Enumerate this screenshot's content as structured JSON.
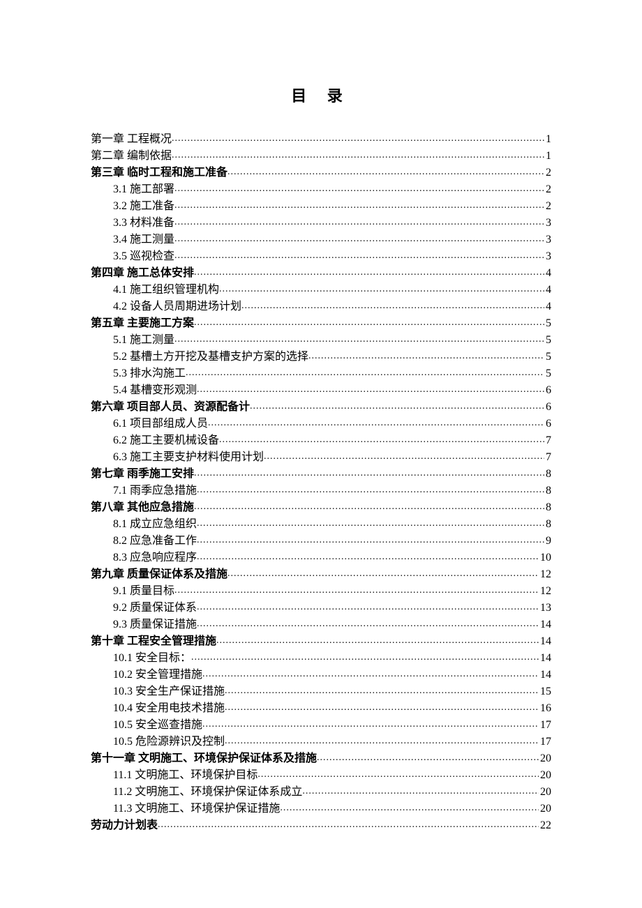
{
  "title": "目 录",
  "entries": [
    {
      "label": "第一章  工程概况",
      "page": "1",
      "bold": false,
      "indent": false
    },
    {
      "label": "第二章  编制依据",
      "page": "1",
      "bold": false,
      "indent": false
    },
    {
      "label": "第三章  临时工程和施工准备",
      "page": "2",
      "bold": true,
      "indent": false
    },
    {
      "label": "3.1 施工部署",
      "page": "2",
      "bold": false,
      "indent": true
    },
    {
      "label": "3.2 施工准备",
      "page": "2",
      "bold": false,
      "indent": true
    },
    {
      "label": "3.3 材料准备",
      "page": "3",
      "bold": false,
      "indent": true
    },
    {
      "label": "3.4 施工测量",
      "page": "3",
      "bold": false,
      "indent": true
    },
    {
      "label": "3.5 巡视检查",
      "page": "3",
      "bold": false,
      "indent": true
    },
    {
      "label": "第四章  施工总体安排",
      "page": "4",
      "bold": true,
      "indent": false
    },
    {
      "label": "4.1 施工组织管理机构",
      "page": "4",
      "bold": false,
      "indent": true
    },
    {
      "label": "4.2 设备人员周期进场计划",
      "page": "4",
      "bold": false,
      "indent": true
    },
    {
      "label": "第五章  主要施工方案",
      "page": "5",
      "bold": true,
      "indent": false
    },
    {
      "label": "5.1 施工测量",
      "page": "5",
      "bold": false,
      "indent": true
    },
    {
      "label": "5.2 基槽土方开挖及基槽支护方案的选择",
      "page": "5",
      "bold": false,
      "indent": true
    },
    {
      "label": "5.3 排水沟施工",
      "page": "5",
      "bold": false,
      "indent": true
    },
    {
      "label": "5.4 基槽变形观测",
      "page": "6",
      "bold": false,
      "indent": true
    },
    {
      "label": "第六章  项目部人员、资源配备计",
      "page": "6",
      "bold": true,
      "indent": false
    },
    {
      "label": "6.1 项目部组成人员",
      "page": "6",
      "bold": false,
      "indent": true
    },
    {
      "label": "6.2 施工主要机械设备",
      "page": "7",
      "bold": false,
      "indent": true
    },
    {
      "label": "6.3 施工主要支护材料使用计划",
      "page": "7",
      "bold": false,
      "indent": true
    },
    {
      "label": "第七章  雨季施工安排",
      "page": "8",
      "bold": true,
      "indent": false
    },
    {
      "label": "7.1 雨季应急措施",
      "page": "8",
      "bold": false,
      "indent": true
    },
    {
      "label": "第八章  其他应急措施",
      "page": "8",
      "bold": true,
      "indent": false
    },
    {
      "label": "8.1 成立应急组织",
      "page": "8",
      "bold": false,
      "indent": true
    },
    {
      "label": "8.2 应急准备工作",
      "page": "9",
      "bold": false,
      "indent": true
    },
    {
      "label": "8.3 应急响应程序",
      "page": "10",
      "bold": false,
      "indent": true
    },
    {
      "label": "第九章  质量保证体系及措施",
      "page": "12",
      "bold": true,
      "indent": false
    },
    {
      "label": "9.1 质量目标",
      "page": "12",
      "bold": false,
      "indent": true
    },
    {
      "label": "9.2 质量保证体系",
      "page": "13",
      "bold": false,
      "indent": true
    },
    {
      "label": "9.3 质量保证措施",
      "page": "14",
      "bold": false,
      "indent": true
    },
    {
      "label": "第十章  工程安全管理措施",
      "page": "14",
      "bold": true,
      "indent": false
    },
    {
      "label": "10.1 安全目标：",
      "page": "14",
      "bold": false,
      "indent": true
    },
    {
      "label": "10.2 安全管理措施",
      "page": "14",
      "bold": false,
      "indent": true
    },
    {
      "label": "10.3 安全生产保证措施",
      "page": "15",
      "bold": false,
      "indent": true
    },
    {
      "label": "10.4 安全用电技术措施",
      "page": "16",
      "bold": false,
      "indent": true
    },
    {
      "label": "10.5 安全巡查措施",
      "page": "17",
      "bold": false,
      "indent": true
    },
    {
      "label": "10.5 危险源辨识及控制",
      "page": "17",
      "bold": false,
      "indent": true
    },
    {
      "label": "第十一章  文明施工、环境保护保证体系及措施",
      "page": "20",
      "bold": true,
      "indent": false
    },
    {
      "label": "11.1 文明施工、环境保护目标",
      "page": "20",
      "bold": false,
      "indent": true
    },
    {
      "label": "11.2 文明施工、环境保护保证体系成立",
      "page": "20",
      "bold": false,
      "indent": true
    },
    {
      "label": "11.3 文明施工、环境保护保证措施",
      "page": "20",
      "bold": false,
      "indent": true
    },
    {
      "label": "劳动力计划表",
      "page": "22",
      "bold": true,
      "indent": false
    }
  ]
}
